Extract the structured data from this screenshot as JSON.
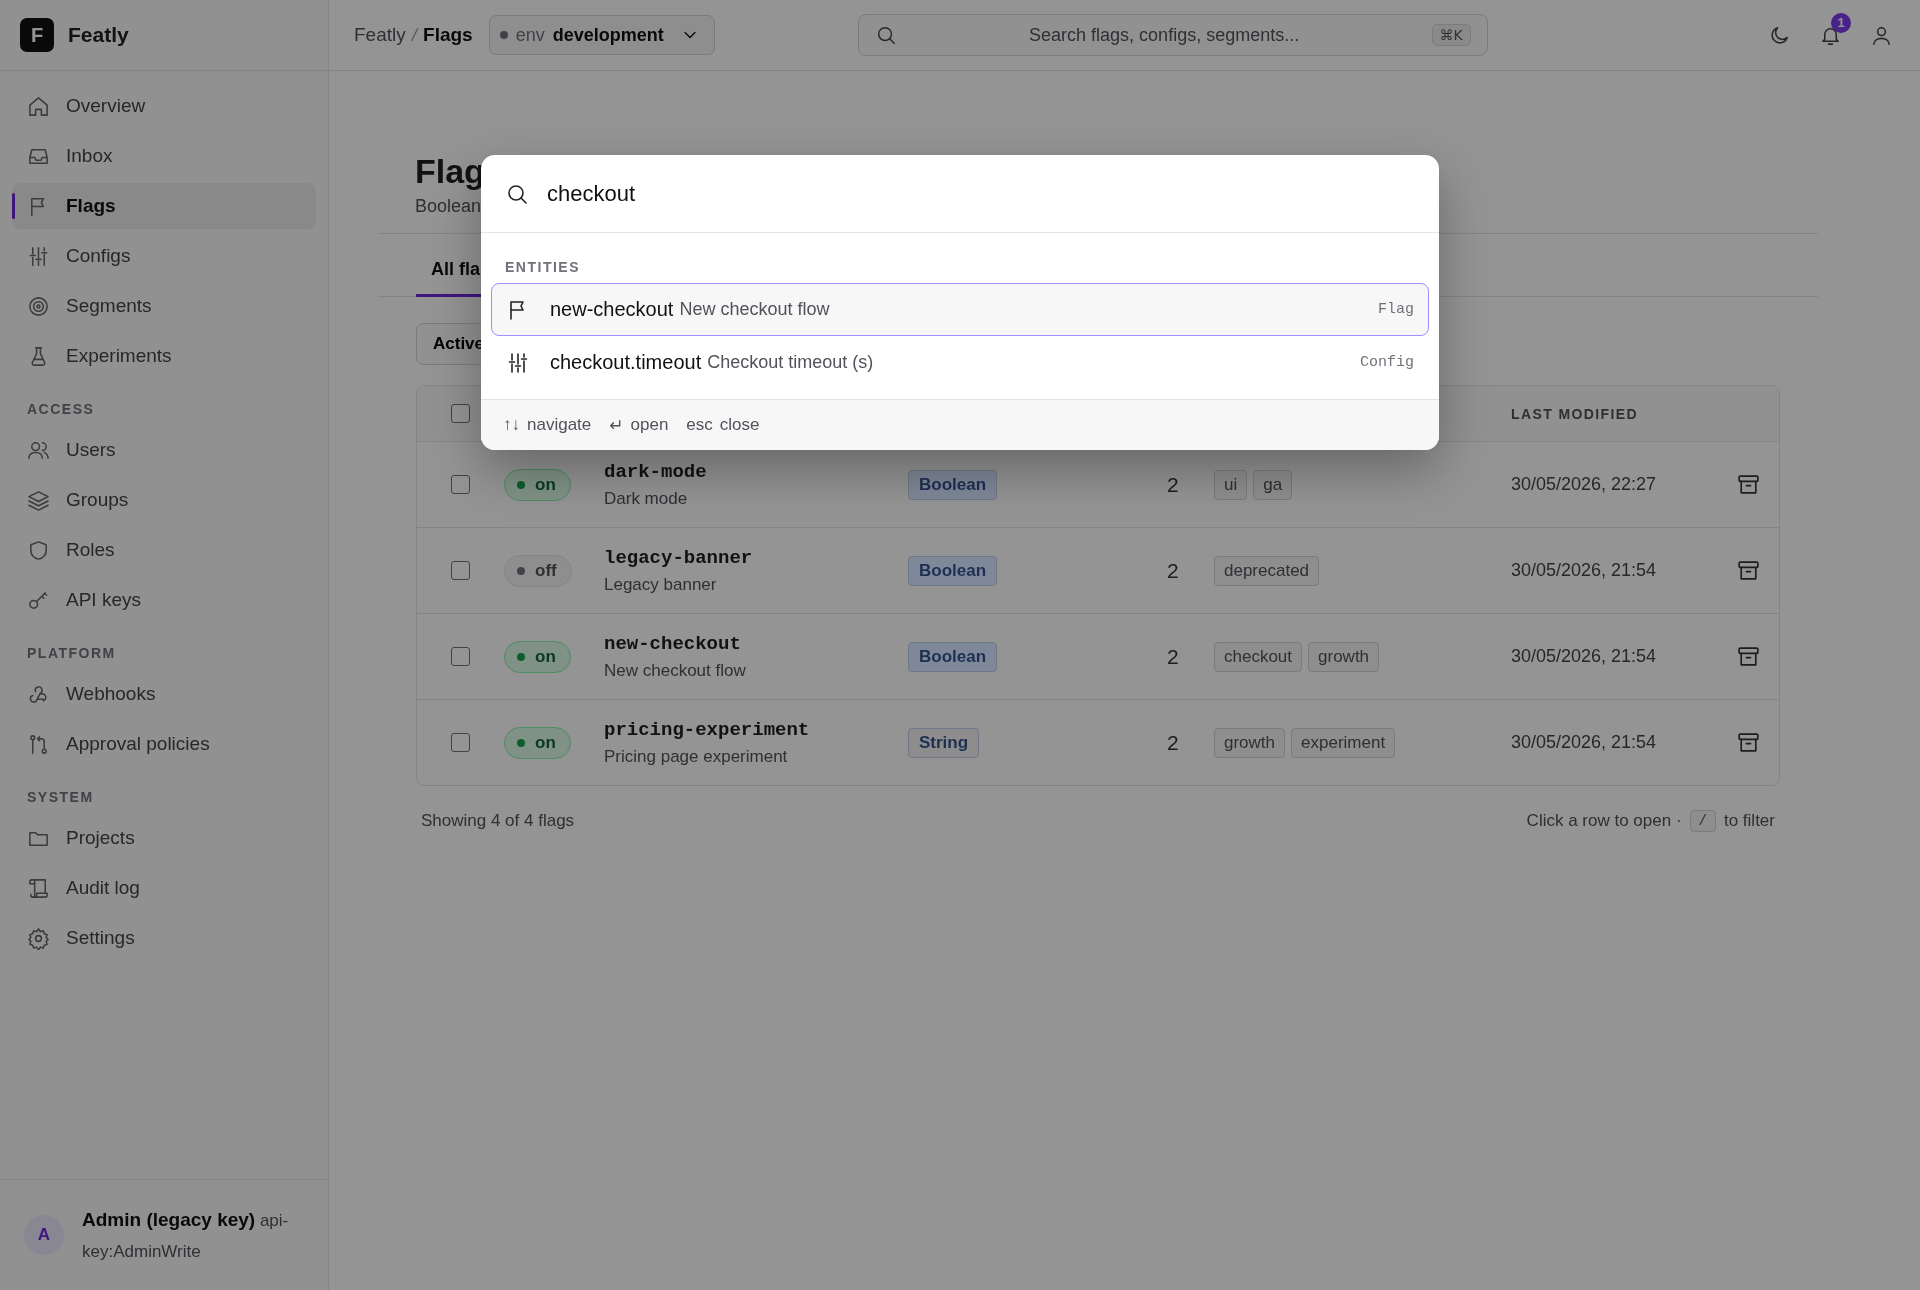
{
  "app": {
    "logo": "F",
    "name": "Featly"
  },
  "breadcrumb": {
    "items": [
      "Featly",
      "Flags"
    ],
    "separator": "/"
  },
  "env": {
    "label": "env",
    "value": "development"
  },
  "search": {
    "placeholder": "Search flags, configs, segments...",
    "shortcut": "⌘K"
  },
  "notifications": {
    "count": "1"
  },
  "sidebar": {
    "sections": [
      {
        "items": [
          {
            "label": "Overview",
            "selected": false
          },
          {
            "label": "Inbox",
            "selected": false
          },
          {
            "label": "Flags",
            "selected": true
          },
          {
            "label": "Configs",
            "selected": false
          },
          {
            "label": "Segments",
            "selected": false
          },
          {
            "label": "Experiments",
            "selected": false
          }
        ]
      },
      {
        "heading": "ACCESS",
        "items": [
          {
            "label": "Users",
            "selected": false
          },
          {
            "label": "Groups",
            "selected": false
          },
          {
            "label": "Roles",
            "selected": false
          },
          {
            "label": "API keys",
            "selected": false
          }
        ]
      },
      {
        "heading": "PLATFORM",
        "items": [
          {
            "label": "Webhooks",
            "selected": false
          },
          {
            "label": "Approval policies",
            "selected": false
          }
        ]
      },
      {
        "heading": "SYSTEM",
        "items": [
          {
            "label": "Projects",
            "selected": false
          },
          {
            "label": "Audit log",
            "selected": false
          },
          {
            "label": "Settings",
            "selected": false
          }
        ]
      }
    ]
  },
  "user": {
    "avatar": "A",
    "text": "**Admin (legacy key)** api-key:AdminWrite"
  },
  "page": {
    "title": "Flag",
    "subtitle": "Boolean",
    "tabs": [
      {
        "label": "All fla",
        "selected": true
      }
    ],
    "filter": "Active"
  },
  "table": {
    "header": {
      "checked": false,
      "last_modified": "LAST MODIFIED"
    },
    "rows": [
      {
        "checked": false,
        "enabled": true,
        "state": "on",
        "name": "dark-mode",
        "description": "Dark mode",
        "type": {
          "label": "Boolean",
          "color": "#7f8898"
        },
        "count": "2",
        "tags": [
          "ui",
          "ga"
        ],
        "modified": "30/05/2026, 22:27"
      },
      {
        "checked": false,
        "enabled": false,
        "state": "off",
        "name": "legacy-banner",
        "description": "Legacy banner",
        "type": {
          "label": "Boolean",
          "color": "#7f8898"
        },
        "count": "2",
        "tags": [
          "deprecated"
        ],
        "modified": "30/05/2026, 21:54"
      },
      {
        "checked": false,
        "enabled": true,
        "state": "on",
        "name": "new-checkout",
        "description": "New checkout flow",
        "type": {
          "label": "Boolean",
          "color": "#7f8898"
        },
        "count": "2",
        "tags": [
          "checkout",
          "growth"
        ],
        "modified": "30/05/2026, 21:54"
      },
      {
        "checked": false,
        "enabled": true,
        "state": "on",
        "name": "pricing-experiment",
        "description": "Pricing page experiment",
        "type": {
          "label": "String",
          "color": "#8d8d8e"
        },
        "count": "2",
        "tags": [
          "growth",
          "experiment"
        ],
        "modified": "30/05/2026, 21:54"
      }
    ]
  },
  "footer": {
    "summary": "Showing 4 of 4 flags",
    "hint_before": "Click a row to open ·",
    "hint_key": "/",
    "hint_after": "to filter"
  },
  "palette": {
    "query": "checkout",
    "section": "ENTITIES",
    "results": [
      {
        "kind": "flag",
        "name": "new-checkout",
        "description": "New checkout flow",
        "type": "Flag",
        "selected": true
      },
      {
        "kind": "config",
        "name": "checkout.timeout",
        "description": "Checkout timeout (s)",
        "type": "Config",
        "selected": false
      }
    ],
    "hints": [
      {
        "key": "↑↓",
        "label": "navigate"
      },
      {
        "key": "↵",
        "label": "open"
      },
      {
        "key": "esc",
        "label": "close"
      }
    ]
  }
}
